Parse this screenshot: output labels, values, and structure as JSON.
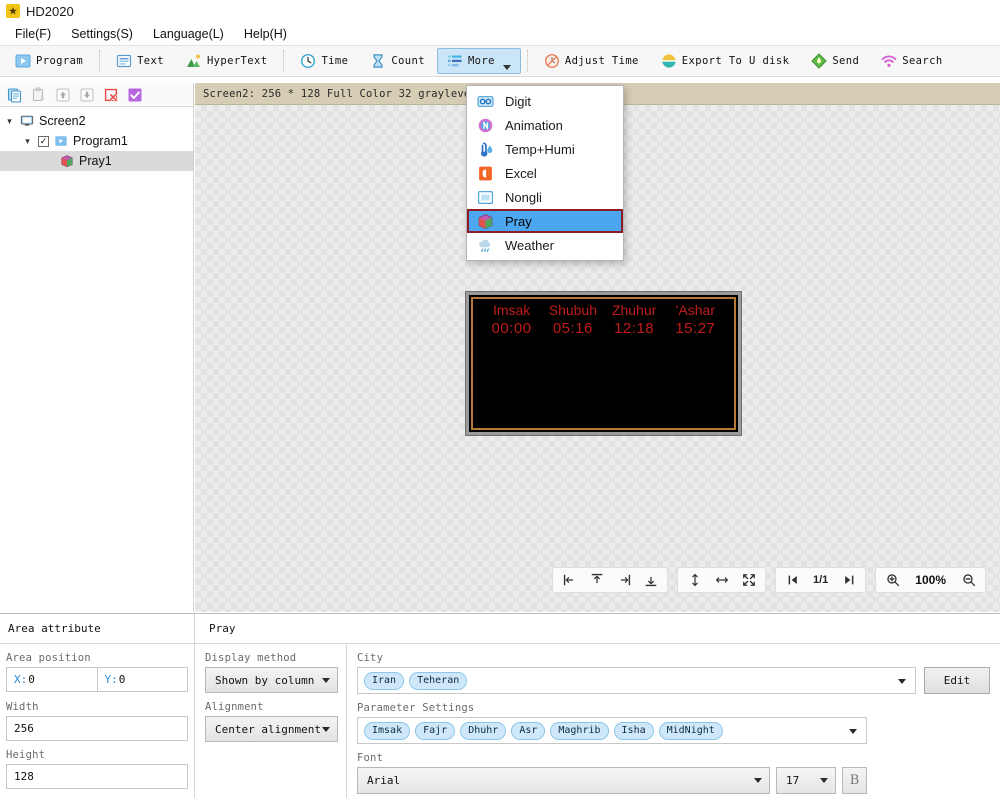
{
  "window": {
    "title": "HD2020",
    "icon": "app-logo-icon"
  },
  "menubar": {
    "items": [
      {
        "label": "File(F)",
        "name": "menu-file"
      },
      {
        "label": "Settings(S)",
        "name": "menu-settings"
      },
      {
        "label": "Language(L)",
        "name": "menu-language"
      },
      {
        "label": "Help(H)",
        "name": "menu-help"
      }
    ]
  },
  "toolbar": {
    "items": [
      {
        "label": "Program",
        "icon": "program-icon"
      },
      {
        "label": "Text",
        "icon": "text-icon"
      },
      {
        "label": "HyperText",
        "icon": "hypertext-icon"
      },
      {
        "label": "Time",
        "icon": "clock-icon"
      },
      {
        "label": "Count",
        "icon": "hourglass-icon"
      },
      {
        "label": "More",
        "icon": "more-icon"
      },
      {
        "label": "Adjust Time",
        "icon": "adjust-time-icon"
      },
      {
        "label": "Export To U disk",
        "icon": "usb-export-icon"
      },
      {
        "label": "Send",
        "icon": "send-icon"
      },
      {
        "label": "Search",
        "icon": "search-wifi-icon"
      }
    ]
  },
  "dropdown": {
    "open": true,
    "selected": "Pray",
    "items": [
      {
        "label": "Digit",
        "icon": "digit-icon"
      },
      {
        "label": "Animation",
        "icon": "animation-icon"
      },
      {
        "label": "Temp+Humi",
        "icon": "temp-humi-icon"
      },
      {
        "label": "Excel",
        "icon": "excel-icon"
      },
      {
        "label": "Nongli",
        "icon": "nongli-icon"
      },
      {
        "label": "Pray",
        "icon": "pray-icon"
      },
      {
        "label": "Weather",
        "icon": "weather-icon"
      }
    ]
  },
  "left_panel": {
    "toolbar_icons": [
      "copy-icon",
      "paste-icon",
      "move-up-icon",
      "move-down-icon",
      "delete-icon",
      "confirm-icon"
    ],
    "tree": {
      "screen": {
        "label": "Screen2",
        "icon": "monitor-icon",
        "expanded": true
      },
      "program": {
        "label": "Program1",
        "icon": "program-node-icon",
        "checked": true,
        "expanded": true
      },
      "area": {
        "label": "Pray1",
        "icon": "pray-node-icon",
        "selected": true
      }
    }
  },
  "infobar": {
    "text": "Screen2: 256 * 128 Full Color 32 grayleve"
  },
  "led_preview": {
    "columns": [
      {
        "label": "Imsak",
        "time": "00:00"
      },
      {
        "label": "Shubuh",
        "time": "05:16"
      },
      {
        "label": "Zhuhur",
        "time": "12:18"
      },
      {
        "label": "'Ashar",
        "time": "15:27"
      }
    ],
    "text_color": "#c11b1b",
    "background": "#000000"
  },
  "canvas_tools": {
    "align_group": [
      "align-left-icon",
      "align-top-icon",
      "align-right-icon",
      "align-bottom-icon"
    ],
    "size_group": [
      "same-height-icon",
      "same-width-icon",
      "same-size-icon"
    ],
    "page_prev": "page-prev-icon",
    "page_indicator": "1/1",
    "page_next": "page-next-icon",
    "zoom_in": "zoom-in-icon",
    "zoom_level": "100%",
    "zoom_out": "zoom-out-icon"
  },
  "bottom_panel": {
    "tab_area": "Area attribute",
    "tab_pray": "Pray",
    "area_attribute": {
      "position_label": "Area position",
      "x_label": "X:",
      "x_value": "0",
      "y_label": "Y:",
      "y_value": "0",
      "width_label": "Width",
      "width_value": "256",
      "height_label": "Height",
      "height_value": "128"
    },
    "pray": {
      "display_method_label": "Display method",
      "display_method_value": "Shown by column",
      "alignment_label": "Alignment",
      "alignment_value": "Center alignment",
      "city_label": "City",
      "city_tags": [
        "Iran",
        "Teheran"
      ],
      "edit_button": "Edit",
      "parameter_label": "Parameter Settings",
      "parameter_tags": [
        "Imsak",
        "Fajr",
        "Dhuhr",
        "Asr",
        "Maghrib",
        "Isha",
        "MidNight"
      ],
      "font_label": "Font",
      "font_name": "Arial",
      "font_size": "17",
      "bold_button": "B"
    }
  }
}
